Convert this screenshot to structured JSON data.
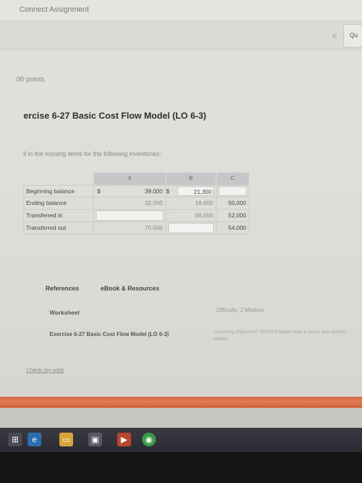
{
  "header": {
    "app_title": "Connect Assignment",
    "next_label": "Qu"
  },
  "nav": {
    "prev_glyph": "<"
  },
  "assignment": {
    "points": "00 points",
    "title": "ercise 6-27 Basic Cost Flow Model (LO 6-3)",
    "instructions": "ll in the missing items for the following inventories:"
  },
  "table": {
    "columns": [
      "A",
      "B",
      "C"
    ],
    "currency": "$",
    "rows": [
      {
        "label": "Beginning balance",
        "a": "39,000",
        "b": "21,300",
        "c": ""
      },
      {
        "label": "Ending balance",
        "a": "32,000",
        "b": "18,600",
        "c": "50,000"
      },
      {
        "label": "Transferred in",
        "a": "",
        "b": "66,000",
        "c": "52,000"
      },
      {
        "label": "Transferred out",
        "a": "70,000",
        "b": "",
        "c": "54,000"
      }
    ]
  },
  "links": {
    "references": "References",
    "ebook": "eBook & Resources",
    "worksheet": "Worksheet",
    "difficulty": "Difficulty: 2 Medium",
    "exercise_ref": "Exercise 6-27 Basic Cost Flow Model (LO 6-3)",
    "learning_objective": "Learning Objective: 06-03 Explain how a basic pro system works.",
    "check_work": "Check my work"
  },
  "taskbar": {
    "icons": [
      "windows-icon",
      "edge-icon",
      "file-explorer-icon",
      "store-icon",
      "media-icon",
      "chrome-icon"
    ]
  }
}
